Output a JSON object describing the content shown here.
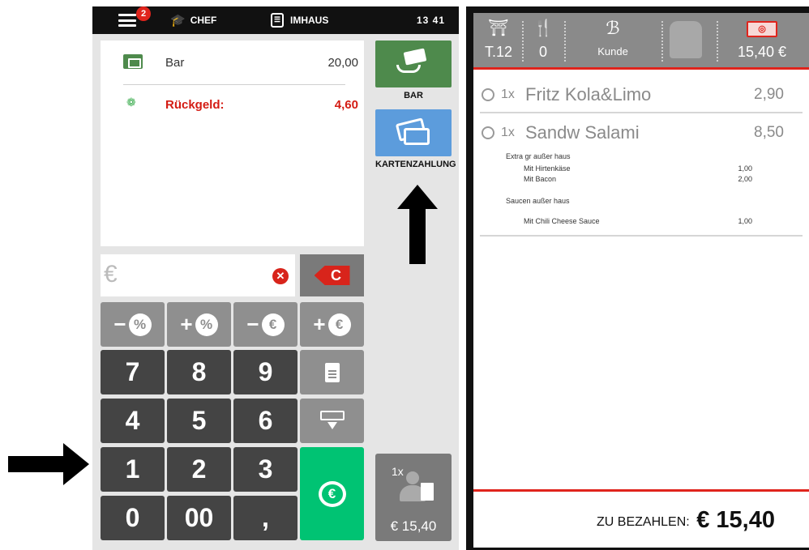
{
  "topbar": {
    "notification_count": "2",
    "user": "CHEF",
    "mode": "IMHAUS",
    "time": "13 41"
  },
  "payments": [
    {
      "icon": "cash-icon",
      "label": "Bar",
      "amount": "20,00"
    },
    {
      "icon": "coins-icon",
      "label": "Rückgeld:",
      "amount": "4,60"
    }
  ],
  "entry": {
    "placeholder": "€"
  },
  "keypad": {
    "clear": "C",
    "discount_minus_pct": "%",
    "discount_plus_pct": "%",
    "discount_minus_eur": "€",
    "discount_plus_eur": "€",
    "minus_sign": "−",
    "plus_sign": "+",
    "digits": [
      "7",
      "8",
      "9",
      "4",
      "5",
      "6",
      "1",
      "2",
      "3",
      "0",
      "00",
      ","
    ]
  },
  "side_buttons": {
    "bar_label": "BAR",
    "card_label": "KARTENZAHLUNG",
    "split_qty": "1x",
    "split_amount": "€ 15,40"
  },
  "order_header": {
    "table": "T.12",
    "guests": "0",
    "customer": "Kunde",
    "total": "15,40 €"
  },
  "order_items": [
    {
      "qty": "1x",
      "name": "Fritz Kola&Limo",
      "price": "2,90"
    },
    {
      "qty": "1x",
      "name": "Sandw Salami",
      "price": "8,50"
    }
  ],
  "modifiers": {
    "group1": "Extra gr außer haus",
    "group1_items": [
      {
        "name": "Mit Hirtenkäse",
        "price": "1,00"
      },
      {
        "name": "Mit Bacon",
        "price": "2,00"
      }
    ],
    "group2": "Saucen außer haus",
    "group2_items": [
      {
        "name": "Mit Chili Cheese Sauce",
        "price": "1,00"
      }
    ]
  },
  "footer": {
    "label": "ZU BEZAHLEN:",
    "amount": "€ 15,40"
  },
  "colors": {
    "accent_red": "#e0241c",
    "cash_green": "#4e8a4c",
    "card_blue": "#5c9cdc",
    "pay_green": "#00c373",
    "dark_key": "#444444",
    "grey_key": "#8f8f8f"
  }
}
